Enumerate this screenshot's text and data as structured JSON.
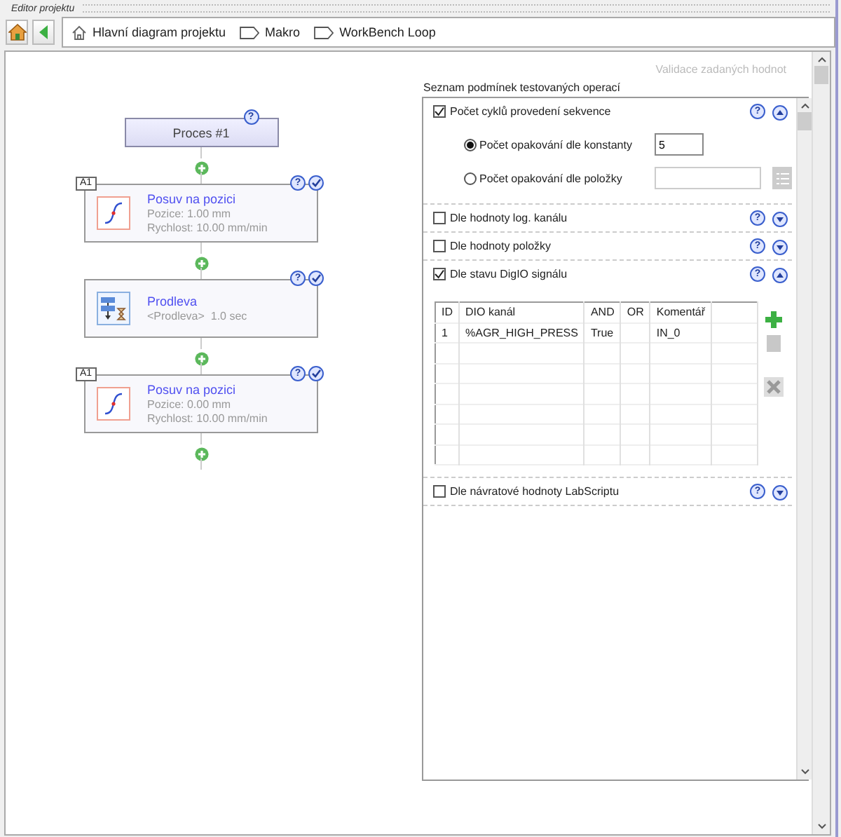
{
  "window": {
    "title": "Editor projektu"
  },
  "breadcrumb": [
    {
      "kind": "home",
      "label": "Hlavní diagram projektu"
    },
    {
      "kind": "tag",
      "label": "Makro"
    },
    {
      "kind": "tag",
      "label": "WorkBench Loop"
    }
  ],
  "diagram": {
    "nodes": [
      {
        "kind": "start",
        "title": "Proces #1",
        "help": "?"
      },
      {
        "kind": "move",
        "badge": "A1",
        "title": "Posuv na pozici",
        "lines": [
          "Pozice: 1.00 mm",
          "Rychlost: 10.00 mm/min"
        ],
        "help": "?"
      },
      {
        "kind": "delay",
        "title": "Prodleva",
        "lines": [
          "<Prodleva>  1.0 sec"
        ],
        "help": "?"
      },
      {
        "kind": "move",
        "badge": "A1",
        "title": "Posuv na pozici",
        "lines": [
          "Pozice: 0.00 mm",
          "Rychlost: 10.00 mm/min"
        ],
        "help": "?"
      }
    ]
  },
  "validation_label": "Validace zadaných hodnot",
  "conditions": {
    "title": "Seznam podmínek testovaných operací",
    "sections": [
      {
        "kind": "radios",
        "label": "Počet cyklů provedení sekvence",
        "checked": true,
        "expanded": true,
        "help": "?",
        "options": [
          {
            "kind": "constant",
            "label": "Počet opakování dle konstanty",
            "selected": true,
            "value": "5"
          },
          {
            "kind": "item",
            "label": "Počet opakování dle položky",
            "selected": false
          }
        ]
      },
      {
        "label": "Dle hodnoty log. kanálu",
        "checked": false,
        "expanded": false,
        "help": "?"
      },
      {
        "label": "Dle hodnoty položky",
        "checked": false,
        "expanded": false,
        "help": "?"
      },
      {
        "kind": "table",
        "label": "Dle stavu DigIO signálu",
        "checked": true,
        "expanded": true,
        "help": "?",
        "columns": [
          "ID",
          "DIO kanál",
          "AND",
          "OR",
          "Komentář"
        ],
        "rows": [
          [
            "1",
            "%AGR_HIGH_PRESS",
            "True",
            "",
            "IN_0"
          ]
        ],
        "tools": [
          {
            "kind": "add",
            "disabled": false
          },
          {
            "kind": "copy",
            "disabled": true
          },
          {
            "kind": "delete",
            "disabled": true
          }
        ]
      },
      {
        "label": "Dle návratové hodnoty LabScriptu",
        "checked": false,
        "expanded": false,
        "help": "?"
      }
    ]
  }
}
